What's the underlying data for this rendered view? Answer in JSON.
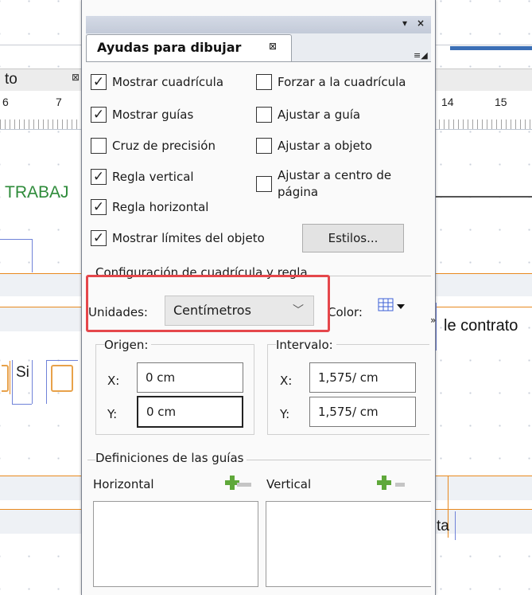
{
  "background": {
    "tab_label": "to",
    "ruler_numbers_left": [
      "6",
      "7"
    ],
    "ruler_numbers_right": [
      "14",
      "15"
    ],
    "trabaj_text": "TRABAJ",
    "contrato_text": "le contrato",
    "si_text": "Si",
    "ta_text": "ta"
  },
  "panel": {
    "title": "Ayudas para dibujar",
    "checkboxes_left": [
      {
        "label": "Mostrar cuadrícula",
        "checked": true
      },
      {
        "label": "Mostrar guías",
        "checked": true
      },
      {
        "label": "Cruz de precisión",
        "checked": false
      },
      {
        "label": "Regla vertical",
        "checked": true
      },
      {
        "label": "Regla horizontal",
        "checked": true
      },
      {
        "label": "Mostrar límites del objeto",
        "checked": true
      }
    ],
    "checkboxes_right": [
      {
        "label": "Forzar a la cuadrícula",
        "checked": false
      },
      {
        "label": "Ajustar a guía",
        "checked": false
      },
      {
        "label": "Ajustar a objeto",
        "checked": false
      },
      {
        "label": "Ajustar a centro de página",
        "checked": false
      }
    ],
    "check_glyph": "✓",
    "styles_button": "Estilos...",
    "grid_section": {
      "title": "Configuración de cuadrícula y regla",
      "units_label": "Unidades:",
      "units_value": "Centímetros",
      "color_label": "Color:",
      "origin": {
        "title": "Origen:",
        "x_label": "X:",
        "x_value": "0 cm",
        "y_label": "Y:",
        "y_value": "0 cm"
      },
      "interval": {
        "title": "Intervalo:",
        "x_label": "X:",
        "x_value": "1,575/ cm",
        "y_label": "Y:",
        "y_value": "1,575/ cm"
      }
    },
    "guides_section": {
      "title": "Definiciones de las guías",
      "horizontal_label": "Horizontal",
      "vertical_label": "Vertical"
    }
  },
  "colors": {
    "highlight": "#e5474b",
    "accent_green": "#2e8b3a",
    "orange_guides": "#e8891f",
    "grid_icon": "#3b5fd6"
  }
}
